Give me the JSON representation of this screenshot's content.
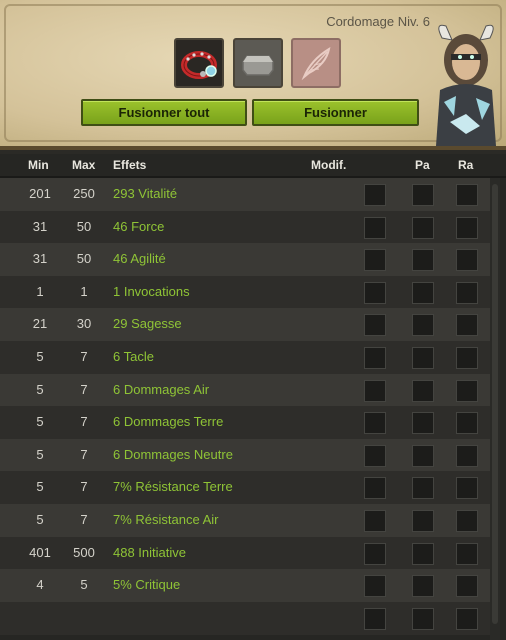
{
  "header": {
    "title": "Cordomage Niv. 6",
    "slots": [
      {
        "icon": "red-collar-item-icon"
      },
      {
        "icon": "grey-hexagon-rune-icon"
      },
      {
        "icon": "feather-icon"
      }
    ],
    "buttons": {
      "fuse_all": "Fusionner tout",
      "fuse": "Fusionner"
    },
    "avatar_icon": "character-portrait-icon"
  },
  "table": {
    "columns": {
      "min": "Min",
      "max": "Max",
      "effects": "Effets",
      "modif": "Modif.",
      "pa": "Pa",
      "ra": "Ra"
    },
    "rows": [
      {
        "min": "201",
        "max": "250",
        "effect": "293 Vitalité"
      },
      {
        "min": "31",
        "max": "50",
        "effect": "46 Force"
      },
      {
        "min": "31",
        "max": "50",
        "effect": "46 Agilité"
      },
      {
        "min": "1",
        "max": "1",
        "effect": "1 Invocations"
      },
      {
        "min": "21",
        "max": "30",
        "effect": "29 Sagesse"
      },
      {
        "min": "5",
        "max": "7",
        "effect": "6 Tacle"
      },
      {
        "min": "5",
        "max": "7",
        "effect": "6 Dommages Air"
      },
      {
        "min": "5",
        "max": "7",
        "effect": "6 Dommages Terre"
      },
      {
        "min": "5",
        "max": "7",
        "effect": "6 Dommages Neutre"
      },
      {
        "min": "5",
        "max": "7",
        "effect": "7% Résistance Terre"
      },
      {
        "min": "5",
        "max": "7",
        "effect": "7% Résistance Air"
      },
      {
        "min": "401",
        "max": "500",
        "effect": "488 Initiative"
      },
      {
        "min": "4",
        "max": "5",
        "effect": "5% Critique"
      },
      {
        "min": "",
        "max": "",
        "effect": ""
      }
    ]
  },
  "colors": {
    "effect_text": "#8fc436",
    "button_green": "#8bb224",
    "parchment": "#d9c9a3"
  }
}
